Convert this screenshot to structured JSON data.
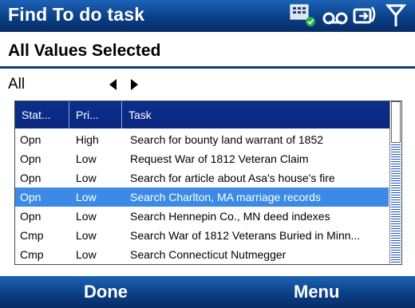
{
  "app": {
    "title": "Find To do task"
  },
  "status_icons": [
    "gprs-icon",
    "voicemail-icon",
    "signal-icon"
  ],
  "filter": {
    "heading": "All Values Selected",
    "value": "All",
    "prev_label": "previous",
    "next_label": "next"
  },
  "grid": {
    "columns": [
      "Stat...",
      "Pri...",
      "Task"
    ],
    "rows": [
      {
        "status": "Opn",
        "priority": "High",
        "task": "Search for bounty land warrant of 1852"
      },
      {
        "status": "Opn",
        "priority": "Low",
        "task": "Request War of 1812 Veteran Claim"
      },
      {
        "status": "Opn",
        "priority": "Low",
        "task": "Search for article about Asa's house's fire"
      },
      {
        "status": "Opn",
        "priority": "Low",
        "task": "Search Charlton, MA marriage records",
        "selected": true
      },
      {
        "status": "Opn",
        "priority": "Low",
        "task": "Search Hennepin Co., MN deed indexes"
      },
      {
        "status": "Cmp",
        "priority": "Low",
        "task": "Search War of 1812 Veterans Buried in Minn..."
      },
      {
        "status": "Cmp",
        "priority": "Low",
        "task": "Search Connecticut Nutmegger"
      }
    ]
  },
  "softkeys": {
    "left": "Done",
    "right": "Menu"
  },
  "colors": {
    "title_bar": "#0b3f86",
    "header": "#0a2f8a",
    "selection": "#3a8ae6"
  }
}
